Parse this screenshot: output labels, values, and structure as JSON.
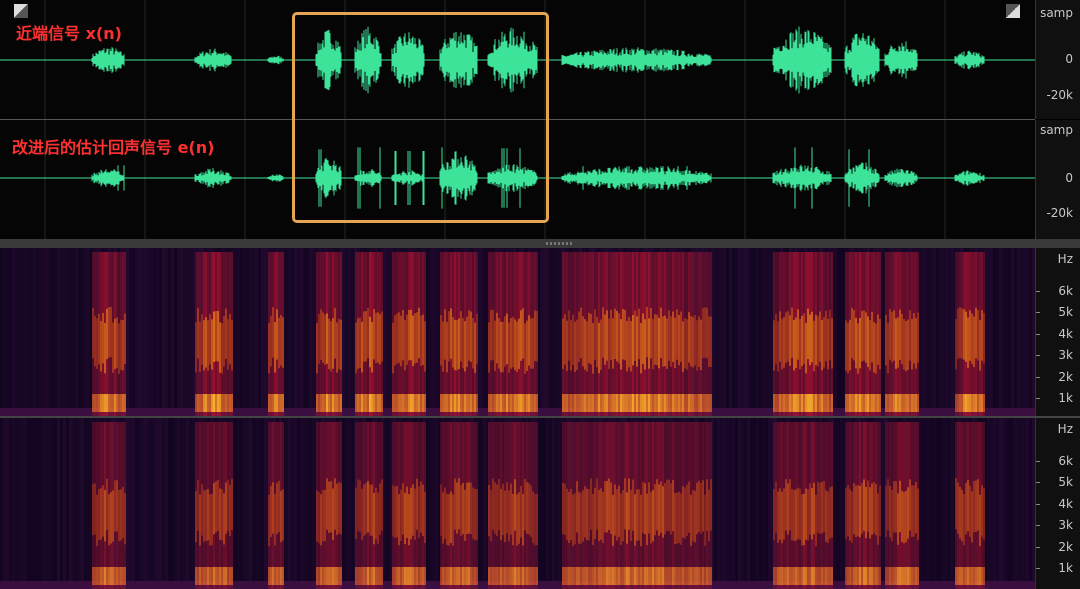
{
  "waveform": {
    "top_label": "近端信号 x(n)",
    "bottom_label": "改进后的估计回声信号 e(n)",
    "ruler_unit": "samp",
    "ruler_zero": "0",
    "ruler_neg": "-20k",
    "wave_color": "#3ee39a",
    "highlight_color": "#e5a552"
  },
  "spectrogram": {
    "unit": "Hz",
    "ticks": [
      "6k",
      "5k",
      "4k",
      "3k",
      "2k",
      "1k"
    ]
  }
}
